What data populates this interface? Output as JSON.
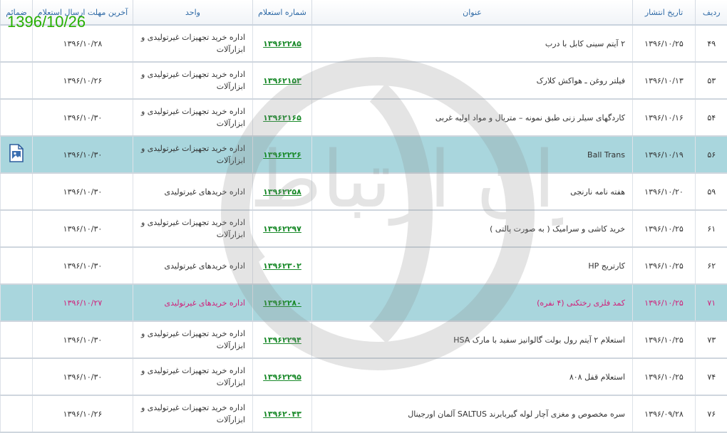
{
  "overlay_date": "1396/10/26",
  "headers": {
    "row": "ردیف",
    "date": "تاریخ انتشار",
    "title": "عنوان",
    "number": "شماره استعلام",
    "unit": "واحد",
    "deadline": "آخرین مهلت ارسال استعلام",
    "attachments": "ضمائم"
  },
  "rows": [
    {
      "row": "۴۹",
      "date": "۱۳۹۶/۱۰/۲۵",
      "title": "۲ آیتم سینی کابل با درب",
      "number": "۱۳۹۶۲۲۸۵",
      "unit": "اداره خرید تجهیزات غیرتولیدی و ابزارآلات",
      "deadline": "۱۳۹۶/۱۰/۲۸"
    },
    {
      "row": "۵۳",
      "date": "۱۳۹۶/۱۰/۱۳",
      "title": "فیلتر روغن ـ هواکش کلارک",
      "number": "۱۳۹۶۲۱۵۳",
      "unit": "اداره خرید تجهیزات غیرتولیدی و ابزارآلات",
      "deadline": "۱۳۹۶/۱۰/۲۶"
    },
    {
      "row": "۵۴",
      "date": "۱۳۹۶/۱۰/۱۶",
      "title": "کاردگهای سیلر زنی طبق نمونه – متریال و مواد اولیه غربی",
      "number": "۱۳۹۶۲۱۶۵",
      "unit": "اداره خرید تجهیزات غیرتولیدی و ابزارآلات",
      "deadline": "۱۳۹۶/۱۰/۳۰"
    },
    {
      "row": "۵۶",
      "date": "۱۳۹۶/۱۰/۱۹",
      "title": "Ball Trans",
      "number": "۱۳۹۶۲۲۲۶",
      "unit": "اداره خرید تجهیزات غیرتولیدی و ابزارآلات",
      "deadline": "۱۳۹۶/۱۰/۳۰"
    },
    {
      "row": "۵۹",
      "date": "۱۳۹۶/۱۰/۲۰",
      "title": "هفته نامه نارنجی",
      "number": "۱۳۹۶۲۲۵۸",
      "unit": "اداره خریدهای غیرتولیدی",
      "deadline": "۱۳۹۶/۱۰/۳۰"
    },
    {
      "row": "۶۱",
      "date": "۱۳۹۶/۱۰/۲۵",
      "title": "خرید کاشی و سرامیک ( به صورت پالتی )",
      "number": "۱۳۹۶۲۲۹۷",
      "unit": "اداره خرید تجهیزات غیرتولیدی و ابزارآلات",
      "deadline": "۱۳۹۶/۱۰/۳۰"
    },
    {
      "row": "۶۲",
      "date": "۱۳۹۶/۱۰/۲۵",
      "title": "کارتریج HP",
      "number": "۱۳۹۶۲۳۰۲",
      "unit": "اداره خریدهای غیرتولیدی",
      "deadline": "۱۳۹۶/۱۰/۳۰"
    },
    {
      "row": "۷۱",
      "date": "۱۳۹۶/۱۰/۲۵",
      "title": "کمد فلزی رختکنی (۴ نفره)",
      "number": "۱۳۹۶۲۲۸۰",
      "unit": "اداره خریدهای غیرتولیدی",
      "deadline": "۱۳۹۶/۱۰/۲۷"
    },
    {
      "row": "۷۳",
      "date": "۱۳۹۶/۱۰/۲۵",
      "title": "استعلام ۲ آیتم رول بولت گالوانیز سفید با مارک HSA",
      "number": "۱۳۹۶۲۲۹۴",
      "unit": "اداره خرید تجهیزات غیرتولیدی و ابزارآلات",
      "deadline": "۱۳۹۶/۱۰/۳۰"
    },
    {
      "row": "۷۴",
      "date": "۱۳۹۶/۱۰/۲۵",
      "title": "استعلام قفل ۸۰۸",
      "number": "۱۳۹۶۲۲۹۵",
      "unit": "اداره خرید تجهیزات غیرتولیدی و ابزارآلات",
      "deadline": "۱۳۹۶/۱۰/۳۰"
    },
    {
      "row": "۷۶",
      "date": "۱۳۹۶/۰۹/۲۸",
      "title": "سره مخصوص و مغزی آچار لوله گیربابرند SALTUS آلمان اورجینال",
      "number": "۱۳۹۶۲۰۴۳",
      "unit": "اداره خرید تجهیزات غیرتولیدی و ابزارآلات",
      "deadline": "۱۳۹۶/۱۰/۲۶"
    }
  ],
  "watermark": {
    "text": "هزاره گستران ارتباط"
  },
  "colors": {
    "header_text": "#2f6aa6",
    "number_link": "#1a8a2a",
    "highlight": "#a9d6dd",
    "alert_text": "#d0207a",
    "overlay_date": "#27b000"
  }
}
